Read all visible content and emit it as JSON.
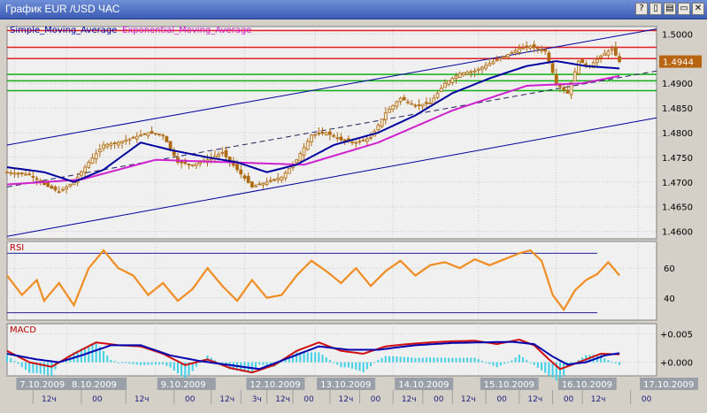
{
  "window": {
    "title": "График EUR /USD  ЧАС",
    "buttons": [
      {
        "id": "help",
        "glyph": "?"
      },
      {
        "id": "restore1",
        "glyph": "▯"
      },
      {
        "id": "restore2",
        "glyph": "▤"
      },
      {
        "id": "minimize",
        "glyph": "▭"
      },
      {
        "id": "close",
        "glyph": "✕"
      }
    ]
  },
  "colors": {
    "bg": "#f0f0f0",
    "grid": "#c8c8c8",
    "bull_candle": "#b06a12",
    "bear_candle": "#b06a12",
    "sma": "#0000a0",
    "ema": "#d020d0",
    "rsi": "#f08c20",
    "rsi_hot": "#d020d0",
    "macd_line": "#d01010",
    "macd_signal": "#0000b0",
    "macd_hist": "#40d0e8",
    "channel": "#0000a0",
    "resistance": "#e02020",
    "support": "#10b010",
    "price_badge": "#b86410",
    "date_label_bg": "#9aa0a8"
  },
  "chart_data": [
    {
      "type": "line",
      "panel": "price",
      "legend": [
        "Simple_Moving_Average",
        "Exponential_Moving_Average"
      ],
      "current_price": "1.4944",
      "ylim": [
        1.4585,
        1.5015
      ],
      "y_ticks": [
        "1.5000",
        "1.4950",
        "1.4900",
        "1.4850",
        "1.4800",
        "1.4750",
        "1.4700",
        "1.4650",
        "1.4600"
      ],
      "resistance_levels": [
        1.5007,
        1.4973,
        1.495
      ],
      "support_levels": [
        1.4918,
        1.4905,
        1.4885
      ],
      "channel": {
        "upper": [
          [
            0,
            1.4775
          ],
          [
            175,
            1.501
          ]
        ],
        "middle": [
          [
            0,
            1.469
          ],
          [
            175,
            1.4925
          ]
        ],
        "lower": [
          [
            0,
            1.459
          ],
          [
            175,
            1.483
          ]
        ]
      },
      "candles_approx": 160,
      "close_anchors": [
        [
          0,
          1.472
        ],
        [
          6,
          1.4715
        ],
        [
          10,
          1.4695
        ],
        [
          14,
          1.468
        ],
        [
          18,
          1.47
        ],
        [
          22,
          1.474
        ],
        [
          26,
          1.4775
        ],
        [
          30,
          1.478
        ],
        [
          34,
          1.479
        ],
        [
          38,
          1.48
        ],
        [
          42,
          1.4795
        ],
        [
          46,
          1.474
        ],
        [
          50,
          1.4735
        ],
        [
          54,
          1.4745
        ],
        [
          58,
          1.476
        ],
        [
          62,
          1.4725
        ],
        [
          66,
          1.469
        ],
        [
          70,
          1.47
        ],
        [
          74,
          1.471
        ],
        [
          78,
          1.4745
        ],
        [
          82,
          1.4795
        ],
        [
          86,
          1.48
        ],
        [
          90,
          1.4785
        ],
        [
          94,
          1.478
        ],
        [
          98,
          1.479
        ],
        [
          102,
          1.484
        ],
        [
          106,
          1.487
        ],
        [
          110,
          1.4855
        ],
        [
          114,
          1.486
        ],
        [
          118,
          1.49
        ],
        [
          122,
          1.492
        ],
        [
          126,
          1.4925
        ],
        [
          130,
          1.494
        ],
        [
          134,
          1.4955
        ],
        [
          138,
          1.497
        ],
        [
          141,
          1.4975
        ],
        [
          145,
          1.4965
        ],
        [
          148,
          1.49
        ],
        [
          151,
          1.488
        ],
        [
          154,
          1.4945
        ],
        [
          157,
          1.4935
        ],
        [
          160,
          1.4955
        ],
        [
          163,
          1.497
        ],
        [
          165,
          1.4944
        ]
      ],
      "sma_anchors": [
        [
          0,
          1.473
        ],
        [
          10,
          1.472
        ],
        [
          18,
          1.47
        ],
        [
          26,
          1.4725
        ],
        [
          36,
          1.478
        ],
        [
          44,
          1.4765
        ],
        [
          54,
          1.475
        ],
        [
          62,
          1.474
        ],
        [
          70,
          1.472
        ],
        [
          78,
          1.4735
        ],
        [
          88,
          1.4775
        ],
        [
          100,
          1.48
        ],
        [
          110,
          1.4835
        ],
        [
          120,
          1.488
        ],
        [
          130,
          1.491
        ],
        [
          140,
          1.4935
        ],
        [
          148,
          1.4945
        ],
        [
          156,
          1.4935
        ],
        [
          165,
          1.493
        ]
      ],
      "ema_anchors": [
        [
          0,
          1.4695
        ],
        [
          20,
          1.4705
        ],
        [
          40,
          1.4745
        ],
        [
          60,
          1.474
        ],
        [
          80,
          1.4735
        ],
        [
          100,
          1.478
        ],
        [
          120,
          1.4845
        ],
        [
          140,
          1.4895
        ],
        [
          155,
          1.49
        ],
        [
          165,
          1.4915
        ]
      ]
    },
    {
      "type": "line",
      "panel": "rsi",
      "legend": [
        "RSI"
      ],
      "ylim": [
        25,
        78
      ],
      "y_ticks": [
        "60",
        "40"
      ],
      "upper_band": 70,
      "lower_band": 30,
      "anchors": [
        [
          0,
          55
        ],
        [
          4,
          42
        ],
        [
          8,
          52
        ],
        [
          10,
          38
        ],
        [
          14,
          50
        ],
        [
          18,
          35
        ],
        [
          22,
          60
        ],
        [
          26,
          72
        ],
        [
          30,
          60
        ],
        [
          34,
          55
        ],
        [
          38,
          42
        ],
        [
          42,
          50
        ],
        [
          46,
          38
        ],
        [
          50,
          46
        ],
        [
          54,
          60
        ],
        [
          58,
          48
        ],
        [
          62,
          38
        ],
        [
          66,
          52
        ],
        [
          70,
          40
        ],
        [
          74,
          42
        ],
        [
          78,
          55
        ],
        [
          82,
          65
        ],
        [
          86,
          58
        ],
        [
          90,
          50
        ],
        [
          94,
          60
        ],
        [
          98,
          48
        ],
        [
          102,
          58
        ],
        [
          106,
          65
        ],
        [
          110,
          55
        ],
        [
          114,
          62
        ],
        [
          118,
          64
        ],
        [
          122,
          60
        ],
        [
          126,
          66
        ],
        [
          130,
          62
        ],
        [
          134,
          66
        ],
        [
          138,
          70
        ],
        [
          141,
          72
        ],
        [
          144,
          65
        ],
        [
          147,
          42
        ],
        [
          150,
          32
        ],
        [
          153,
          45
        ],
        [
          156,
          52
        ],
        [
          159,
          56
        ],
        [
          162,
          64
        ],
        [
          165,
          55
        ]
      ]
    },
    {
      "type": "line",
      "panel": "macd",
      "legend": [
        "MACD"
      ],
      "ylim": [
        -0.0024,
        0.0068
      ],
      "y_ticks": [
        "+0.005",
        "+0.000"
      ],
      "macd_anchors": [
        [
          0,
          0.002
        ],
        [
          6,
          0.0
        ],
        [
          12,
          -0.0008
        ],
        [
          18,
          0.0015
        ],
        [
          24,
          0.0035
        ],
        [
          30,
          0.003
        ],
        [
          36,
          0.0028
        ],
        [
          42,
          0.0015
        ],
        [
          48,
          -0.0005
        ],
        [
          54,
          0.0005
        ],
        [
          60,
          -0.001
        ],
        [
          66,
          -0.0018
        ],
        [
          72,
          -0.0005
        ],
        [
          78,
          0.002
        ],
        [
          84,
          0.0035
        ],
        [
          90,
          0.002
        ],
        [
          96,
          0.0015
        ],
        [
          102,
          0.0028
        ],
        [
          108,
          0.0032
        ],
        [
          114,
          0.0035
        ],
        [
          120,
          0.0037
        ],
        [
          126,
          0.0038
        ],
        [
          132,
          0.0032
        ],
        [
          138,
          0.004
        ],
        [
          142,
          0.003
        ],
        [
          146,
          0.0005
        ],
        [
          149,
          -0.0012
        ],
        [
          152,
          -0.0005
        ],
        [
          156,
          0.0005
        ],
        [
          160,
          0.0015
        ],
        [
          165,
          0.0014
        ]
      ],
      "signal_anchors": [
        [
          0,
          0.0015
        ],
        [
          8,
          0.0005
        ],
        [
          14,
          0.0
        ],
        [
          20,
          0.0012
        ],
        [
          28,
          0.003
        ],
        [
          36,
          0.003
        ],
        [
          44,
          0.0012
        ],
        [
          52,
          0.0002
        ],
        [
          60,
          -0.0005
        ],
        [
          68,
          -0.0012
        ],
        [
          76,
          0.0008
        ],
        [
          84,
          0.0028
        ],
        [
          92,
          0.0022
        ],
        [
          100,
          0.0022
        ],
        [
          110,
          0.003
        ],
        [
          120,
          0.0034
        ],
        [
          128,
          0.0035
        ],
        [
          136,
          0.0036
        ],
        [
          142,
          0.0032
        ],
        [
          147,
          0.001
        ],
        [
          151,
          -0.0004
        ],
        [
          156,
          0.0
        ],
        [
          161,
          0.0012
        ],
        [
          165,
          0.0016
        ]
      ]
    }
  ],
  "x_axis": {
    "date_labels": [
      "7.10.2009",
      "8.10.2009",
      "9.10.2009",
      "12.10.2009",
      "13.10.2009",
      "14.10.2009",
      "15.10.2009",
      "16.10.2009",
      "17.10.2009"
    ],
    "date_positions": [
      2,
      16,
      40,
      64,
      83,
      104,
      127,
      148,
      170
    ],
    "hour_labels": [
      "12ч",
      "00",
      "12ч",
      "00",
      "12ч",
      "3ч",
      "12ч",
      "00",
      "12ч",
      "00",
      "12ч",
      "00",
      "12ч",
      "00",
      "12ч",
      "00",
      "12ч",
      "00"
    ],
    "hour_positions": [
      7,
      20,
      32,
      45,
      55,
      63,
      70,
      77,
      87,
      95,
      104,
      112,
      120,
      129,
      138,
      147,
      155,
      168
    ]
  }
}
